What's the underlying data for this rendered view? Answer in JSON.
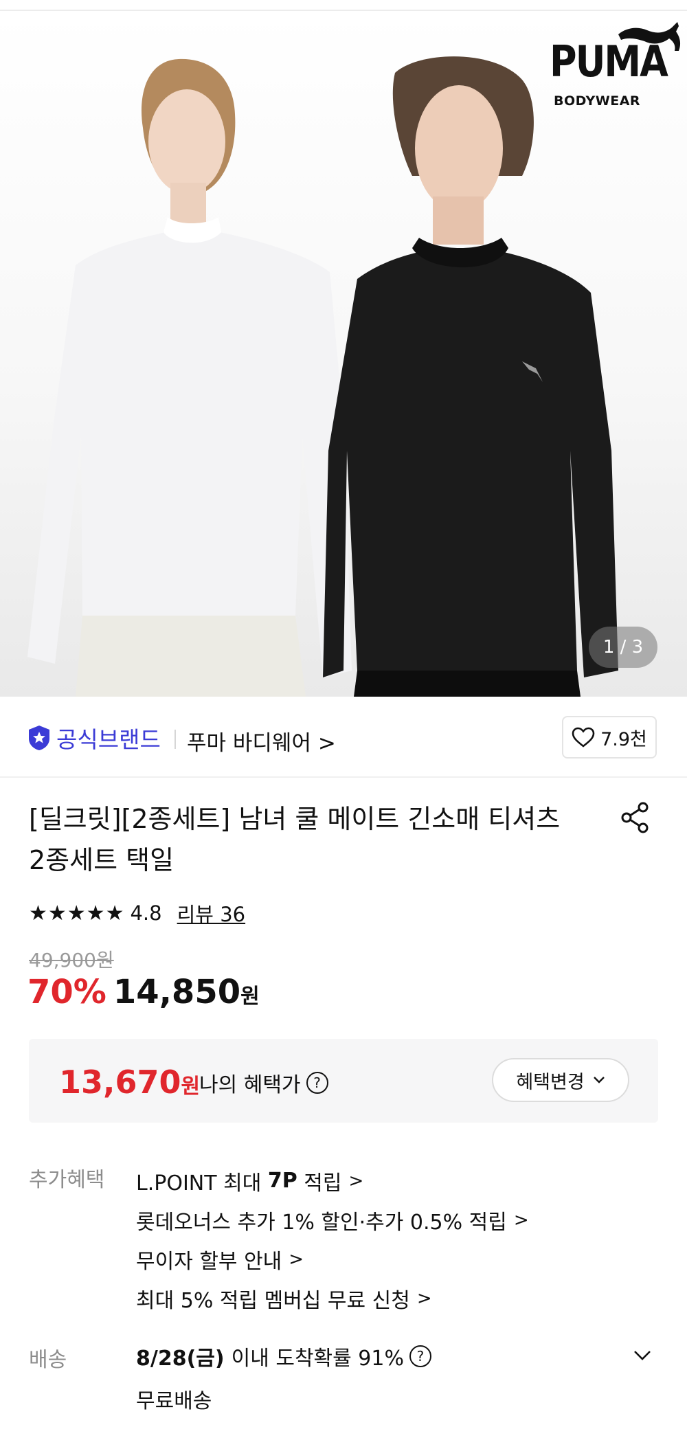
{
  "gallery": {
    "brand_logo_text": "PUMA",
    "brand_logo_sub": "BODYWEAR",
    "counter": "1 / 3"
  },
  "store": {
    "official_label": "공식브랜드",
    "name": "푸마 바디웨어 >",
    "likes": "7.9천"
  },
  "product": {
    "title_line1": "[딜크릿][2종세트] 남녀 쿨 메이트 긴소매 티셔츠",
    "title_line2": "2종세트 택일",
    "stars": "★★★★★",
    "rating": "4.8",
    "review_label": "리뷰 36",
    "original_price": "49,900원",
    "discount": "70%",
    "price": "14,850",
    "price_unit": "원"
  },
  "benefit_price": {
    "value": "13,670",
    "unit": "원",
    "label": "나의 혜택가",
    "help": "?",
    "change_button": "혜택변경"
  },
  "extra_benefits": {
    "label": "추가혜택",
    "items": [
      {
        "pre": "L.POINT 최대 ",
        "bold": "7P",
        "post": " 적립"
      },
      {
        "pre": "롯데오너스 추가 1% 할인·추가 0.5% 적립",
        "bold": "",
        "post": ""
      },
      {
        "pre": "무이자 할부 안내",
        "bold": "",
        "post": ""
      },
      {
        "pre": "최대 5% 적립 멤버십 무료 신청",
        "bold": "",
        "post": ""
      }
    ],
    "arrow": ">"
  },
  "shipping": {
    "label": "배송",
    "date": "8/28(금)",
    "text": "이내 도착확률 91%",
    "help": "?",
    "fee": "무료배송"
  },
  "colors": {
    "accent_red": "#e0262c",
    "official_blue": "#3b3bd6",
    "muted_gray": "#8c8c8c"
  }
}
